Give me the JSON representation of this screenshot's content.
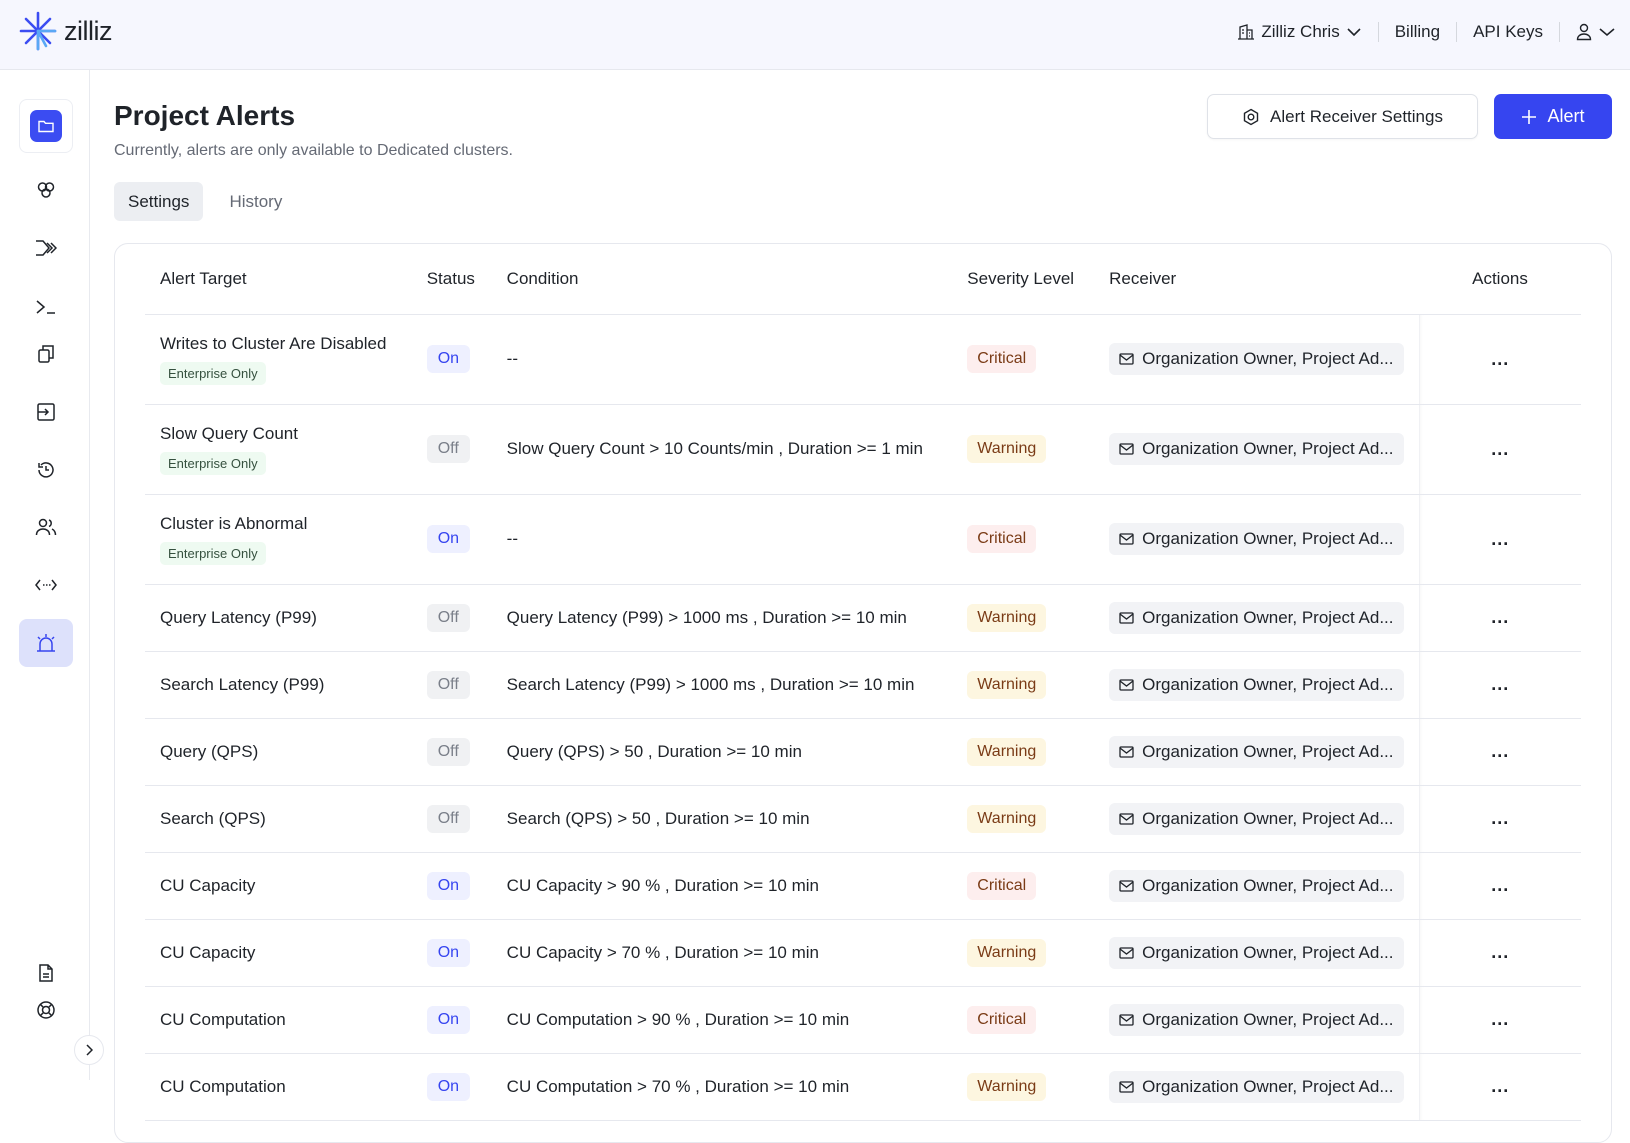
{
  "header": {
    "brand": "zilliz",
    "org_name": "Zilliz Chris",
    "billing": "Billing",
    "api_keys": "API Keys"
  },
  "sidebar": {
    "items": [
      {
        "name": "project",
        "icon": "folder-icon",
        "active": false
      },
      {
        "name": "clusters",
        "icon": "clusters-icon"
      },
      {
        "name": "pipelines",
        "icon": "pipeline-icon"
      },
      {
        "name": "playground",
        "icon": "terminal-icon"
      },
      {
        "name": "collections",
        "icon": "copy-icon"
      },
      {
        "name": "migrations",
        "icon": "import-icon"
      },
      {
        "name": "backups",
        "icon": "history-icon"
      },
      {
        "name": "members",
        "icon": "users-icon"
      },
      {
        "name": "integrations",
        "icon": "code-icon"
      },
      {
        "name": "alerts",
        "icon": "alarm-icon",
        "active": true
      }
    ],
    "bottom": [
      {
        "name": "docs",
        "icon": "document-icon"
      },
      {
        "name": "support",
        "icon": "lifebuoy-icon"
      }
    ]
  },
  "page": {
    "title": "Project Alerts",
    "subtitle": "Currently, alerts are only available to Dedicated clusters.",
    "receiver_settings_label": "Alert Receiver Settings",
    "add_alert_label": "Alert",
    "tabs": [
      {
        "label": "Settings",
        "active": true
      },
      {
        "label": "History",
        "active": false
      }
    ]
  },
  "table": {
    "columns": [
      "Alert Target",
      "Status",
      "Condition",
      "Severity Level",
      "Receiver",
      "Actions"
    ],
    "rows": [
      {
        "target": "Writes to Cluster Are Disabled",
        "tag": "Enterprise Only",
        "status": "On",
        "condition": "--",
        "severity": "Critical",
        "receiver": "Organization Owner, Project Ad..."
      },
      {
        "target": "Slow Query Count",
        "tag": "Enterprise Only",
        "status": "Off",
        "condition": "Slow Query Count > 10 Counts/min , Duration >= 1 min",
        "severity": "Warning",
        "receiver": "Organization Owner, Project Ad..."
      },
      {
        "target": "Cluster is Abnormal",
        "tag": "Enterprise Only",
        "status": "On",
        "condition": "--",
        "severity": "Critical",
        "receiver": "Organization Owner, Project Ad..."
      },
      {
        "target": "Query Latency (P99)",
        "tag": "",
        "status": "Off",
        "condition": "Query Latency (P99) > 1000 ms , Duration >= 10 min",
        "severity": "Warning",
        "receiver": "Organization Owner, Project Ad..."
      },
      {
        "target": "Search Latency (P99)",
        "tag": "",
        "status": "Off",
        "condition": "Search Latency (P99) > 1000 ms , Duration >= 10 min",
        "severity": "Warning",
        "receiver": "Organization Owner, Project Ad..."
      },
      {
        "target": "Query (QPS)",
        "tag": "",
        "status": "Off",
        "condition": "Query (QPS) > 50 , Duration >= 10 min",
        "severity": "Warning",
        "receiver": "Organization Owner, Project Ad..."
      },
      {
        "target": "Search (QPS)",
        "tag": "",
        "status": "Off",
        "condition": "Search (QPS) > 50 , Duration >= 10 min",
        "severity": "Warning",
        "receiver": "Organization Owner, Project Ad..."
      },
      {
        "target": "CU Capacity",
        "tag": "",
        "status": "On",
        "condition": "CU Capacity > 90 % , Duration >= 10 min",
        "severity": "Critical",
        "receiver": "Organization Owner, Project Ad..."
      },
      {
        "target": "CU Capacity",
        "tag": "",
        "status": "On",
        "condition": "CU Capacity > 70 % , Duration >= 10 min",
        "severity": "Warning",
        "receiver": "Organization Owner, Project Ad..."
      },
      {
        "target": "CU Computation",
        "tag": "",
        "status": "On",
        "condition": "CU Computation > 90 % , Duration >= 10 min",
        "severity": "Critical",
        "receiver": "Organization Owner, Project Ad..."
      },
      {
        "target": "CU Computation",
        "tag": "",
        "status": "On",
        "condition": "CU Computation > 70 % , Duration >= 10 min",
        "severity": "Warning",
        "receiver": "Organization Owner, Project Ad..."
      }
    ],
    "actions_label": "..."
  },
  "colors": {
    "accent": "#3645f0",
    "critical_bg": "#fdeeee",
    "warning_bg": "#fdf6e0",
    "on_bg": "#eef0ff"
  }
}
